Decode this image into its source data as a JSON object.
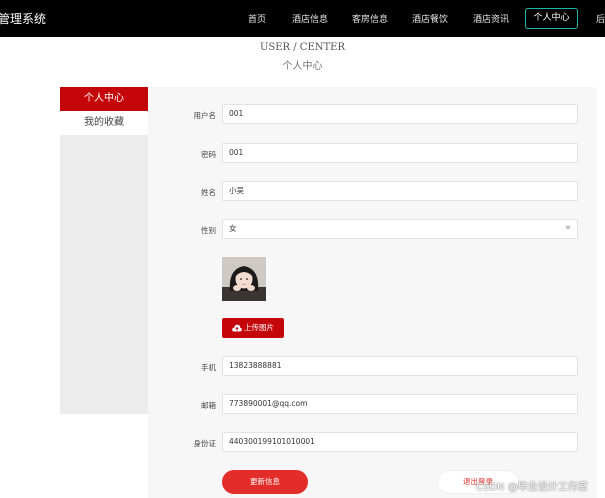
{
  "app": {
    "title": "管理系统"
  },
  "nav": {
    "items": [
      "首页",
      "酒店信息",
      "客房信息",
      "酒店餐饮",
      "酒店资讯"
    ],
    "active": "个人中心",
    "cut": "后"
  },
  "header": {
    "title_en": "USER / CENTER",
    "title_cn": "个人中心"
  },
  "sidebar": {
    "items": [
      {
        "label": "个人中心",
        "active": true
      },
      {
        "label": "我的收藏",
        "active": false
      }
    ]
  },
  "form": {
    "username": {
      "label": "用户名",
      "value": "001"
    },
    "password": {
      "label": "密码",
      "value": "001"
    },
    "name": {
      "label": "姓名",
      "value": "小吴"
    },
    "gender": {
      "label": "性别",
      "value": "女"
    },
    "upload_label": "上传图片",
    "phone": {
      "label": "手机",
      "value": "13823888881"
    },
    "email": {
      "label": "邮箱",
      "value": "773890001@qq.com"
    },
    "idcard": {
      "label": "身份证",
      "value": "440300199101010001"
    }
  },
  "buttons": {
    "update": "更新信息",
    "logout": "退出登录"
  },
  "watermark": "CSDN @毕业设计工作室",
  "colors": {
    "accent": "#c4050a",
    "button_red": "#e22d2a",
    "active_border": "#1fb5a6",
    "topbar": "#000000"
  }
}
